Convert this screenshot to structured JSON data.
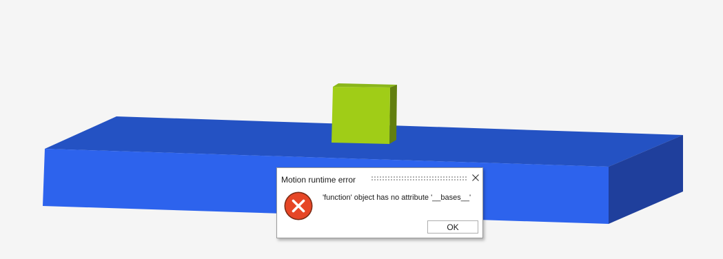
{
  "dialog": {
    "title": "Motion runtime error",
    "message": "'function' object has no attribute '__bases__'",
    "ok_label": "OK",
    "icon": "error-icon"
  },
  "scene": {
    "platform_color": "#2a5fe8",
    "cube_color": "#9ecd16",
    "background_color": "#f5f5f5"
  }
}
